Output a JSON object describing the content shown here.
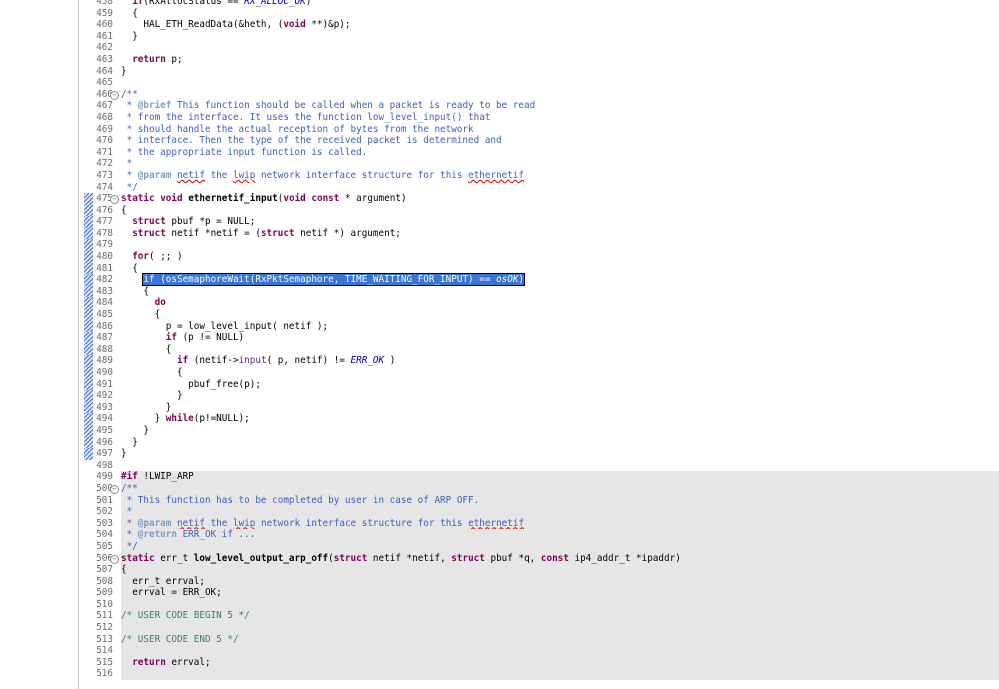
{
  "editor": {
    "lines": [
      {
        "n": "458",
        "g": false,
        "f": false,
        "h": false,
        "html": "  <span class=\"kw\">if</span>(RxAllocStatus == <span class=\"it\">RX_ALLOC_OK</span>)"
      },
      {
        "n": "459",
        "g": false,
        "f": false,
        "h": false,
        "html": "  {"
      },
      {
        "n": "460",
        "g": false,
        "f": false,
        "h": false,
        "html": "    HAL_ETH_ReadData(&amp;heth, (<span class=\"kw\">void</span> **)&amp;p);"
      },
      {
        "n": "461",
        "g": false,
        "f": false,
        "h": false,
        "html": "  }"
      },
      {
        "n": "462",
        "g": false,
        "f": false,
        "h": false,
        "html": ""
      },
      {
        "n": "463",
        "g": false,
        "f": false,
        "h": false,
        "html": "  <span class=\"kw\">return</span> p;"
      },
      {
        "n": "464",
        "g": false,
        "f": false,
        "h": false,
        "html": "}"
      },
      {
        "n": "465",
        "g": false,
        "f": false,
        "h": false,
        "html": ""
      },
      {
        "n": "466",
        "g": false,
        "f": true,
        "h": false,
        "html": "<span class=\"cm-doc\">/**</span>"
      },
      {
        "n": "467",
        "g": false,
        "f": false,
        "h": false,
        "html": "<span class=\"cm-doc\"> * <span class=\"tag\">@brief</span> This function should be called when a packet is ready to be read</span>"
      },
      {
        "n": "468",
        "g": false,
        "f": false,
        "h": false,
        "html": "<span class=\"cm-doc\"> * from the interface. It uses the function low_level_input() that</span>"
      },
      {
        "n": "469",
        "g": false,
        "f": false,
        "h": false,
        "html": "<span class=\"cm-doc\"> * should handle the actual reception of bytes from the network</span>"
      },
      {
        "n": "470",
        "g": false,
        "f": false,
        "h": false,
        "html": "<span class=\"cm-doc\"> * interface. Then the type of the received packet is determined and</span>"
      },
      {
        "n": "471",
        "g": false,
        "f": false,
        "h": false,
        "html": "<span class=\"cm-doc\"> * the appropriate input function is called.</span>"
      },
      {
        "n": "472",
        "g": false,
        "f": false,
        "h": false,
        "html": "<span class=\"cm-doc\"> *</span>"
      },
      {
        "n": "473",
        "g": false,
        "f": false,
        "h": false,
        "html": "<span class=\"cm-doc\"> * <span class=\"tag\">@param</span> <span class=\"squig\">netif</span> the <span class=\"squig\">lwip</span> network interface structure for this <span class=\"squig\">ethernetif</span></span>"
      },
      {
        "n": "474",
        "g": false,
        "f": false,
        "h": false,
        "html": "<span class=\"cm-doc\"> */</span>"
      },
      {
        "n": "475",
        "g": false,
        "f": true,
        "h": true,
        "html": "<span class=\"kw\">static</span> <span class=\"kw\">void</span> <b>ethernetif_input</b>(<span class=\"kw\">void</span> <span class=\"kw\">const</span> * argument)"
      },
      {
        "n": "476",
        "g": false,
        "f": false,
        "h": true,
        "html": "{"
      },
      {
        "n": "477",
        "g": false,
        "f": false,
        "h": true,
        "html": "  <span class=\"kw\">struct</span> pbuf *p = NULL;"
      },
      {
        "n": "478",
        "g": false,
        "f": false,
        "h": true,
        "html": "  <span class=\"kw\">struct</span> netif *netif = (<span class=\"kw\">struct</span> netif *) argument;"
      },
      {
        "n": "479",
        "g": false,
        "f": false,
        "h": true,
        "html": ""
      },
      {
        "n": "480",
        "g": false,
        "f": false,
        "h": true,
        "html": "  <span class=\"kw\">for</span>( ;; )"
      },
      {
        "n": "481",
        "g": false,
        "f": false,
        "h": true,
        "html": "  {"
      },
      {
        "n": "482",
        "g": false,
        "f": false,
        "h": true,
        "html": "    <span class=\"sel\"><span>if</span> (osSemaphoreWait(RxPktSemaphore, TIME_WAITING_FOR_INPUT) == <span class=\"it\">osOK</span>)</span>"
      },
      {
        "n": "483",
        "g": false,
        "f": false,
        "h": true,
        "html": "    {"
      },
      {
        "n": "484",
        "g": false,
        "f": false,
        "h": true,
        "html": "      <span class=\"kw\">do</span>"
      },
      {
        "n": "485",
        "g": false,
        "f": false,
        "h": true,
        "html": "      {"
      },
      {
        "n": "486",
        "g": false,
        "f": false,
        "h": true,
        "html": "        p = low_level_input( netif );"
      },
      {
        "n": "487",
        "g": false,
        "f": false,
        "h": true,
        "html": "        <span class=\"kw\">if</span> (p != NULL)"
      },
      {
        "n": "488",
        "g": false,
        "f": false,
        "h": true,
        "html": "        {"
      },
      {
        "n": "489",
        "g": false,
        "f": false,
        "h": true,
        "html": "          <span class=\"kw\">if</span> (netif-&gt;<span class=\"fn\">input</span>( p, netif) != <span class=\"it\">ERR_OK</span> )"
      },
      {
        "n": "490",
        "g": false,
        "f": false,
        "h": true,
        "html": "          {"
      },
      {
        "n": "491",
        "g": false,
        "f": false,
        "h": true,
        "html": "            pbuf_free(p);"
      },
      {
        "n": "492",
        "g": false,
        "f": false,
        "h": true,
        "html": "          }"
      },
      {
        "n": "493",
        "g": false,
        "f": false,
        "h": true,
        "html": "        }"
      },
      {
        "n": "494",
        "g": false,
        "f": false,
        "h": true,
        "html": "      } <span class=\"kw\">while</span>(p!=NULL);"
      },
      {
        "n": "495",
        "g": false,
        "f": false,
        "h": true,
        "html": "    }"
      },
      {
        "n": "496",
        "g": false,
        "f": false,
        "h": true,
        "html": "  }"
      },
      {
        "n": "497",
        "g": false,
        "f": false,
        "h": true,
        "html": "}"
      },
      {
        "n": "498",
        "g": false,
        "f": false,
        "h": false,
        "html": ""
      },
      {
        "n": "499",
        "g": true,
        "f": false,
        "h": false,
        "html": "<span class=\"pp\">#if</span> !LWIP_ARP"
      },
      {
        "n": "500",
        "g": true,
        "f": true,
        "h": false,
        "html": "<span class=\"cm-doc\">/**</span>"
      },
      {
        "n": "501",
        "g": true,
        "f": false,
        "h": false,
        "html": "<span class=\"cm-doc\"> * This function has to be completed by user in case of ARP OFF.</span>"
      },
      {
        "n": "502",
        "g": true,
        "f": false,
        "h": false,
        "html": "<span class=\"cm-doc\"> *</span>"
      },
      {
        "n": "503",
        "g": true,
        "f": false,
        "h": false,
        "html": "<span class=\"cm-doc\"> * <span class=\"tag\">@param</span> <span class=\"squig\">netif</span> the <span class=\"squig\">lwip</span> network interface structure for this <span class=\"squig\">ethernetif</span></span>"
      },
      {
        "n": "504",
        "g": true,
        "f": false,
        "h": false,
        "html": "<span class=\"cm-doc\"> * <span class=\"tag\">@return</span> ERR_OK if ...</span>"
      },
      {
        "n": "505",
        "g": true,
        "f": false,
        "h": false,
        "html": "<span class=\"cm-doc\"> */</span>"
      },
      {
        "n": "506",
        "g": true,
        "f": true,
        "h": false,
        "html": "<span class=\"kw\">static</span> err_t <b>low_level_output_arp_off</b>(<span class=\"kw\">struct</span> netif *netif, <span class=\"kw\">struct</span> pbuf *q, <span class=\"kw\">const</span> ip4_addr_t *ipaddr)"
      },
      {
        "n": "507",
        "g": true,
        "f": false,
        "h": false,
        "html": "{"
      },
      {
        "n": "508",
        "g": true,
        "f": false,
        "h": false,
        "html": "  err_t errval;"
      },
      {
        "n": "509",
        "g": true,
        "f": false,
        "h": false,
        "html": "  errval = ERR_OK;"
      },
      {
        "n": "510",
        "g": true,
        "f": false,
        "h": false,
        "html": ""
      },
      {
        "n": "511",
        "g": true,
        "f": false,
        "h": false,
        "html": "<span class=\"cm\">/* USER CODE BEGIN 5 */</span>"
      },
      {
        "n": "512",
        "g": true,
        "f": false,
        "h": false,
        "html": ""
      },
      {
        "n": "513",
        "g": true,
        "f": false,
        "h": false,
        "html": "<span class=\"cm\">/* USER CODE END 5 */</span>"
      },
      {
        "n": "514",
        "g": true,
        "f": false,
        "h": false,
        "html": ""
      },
      {
        "n": "515",
        "g": true,
        "f": false,
        "h": false,
        "html": "  <span class=\"kw\">return</span> errval;"
      },
      {
        "n": "516",
        "g": true,
        "f": false,
        "h": false,
        "html": ""
      }
    ]
  }
}
